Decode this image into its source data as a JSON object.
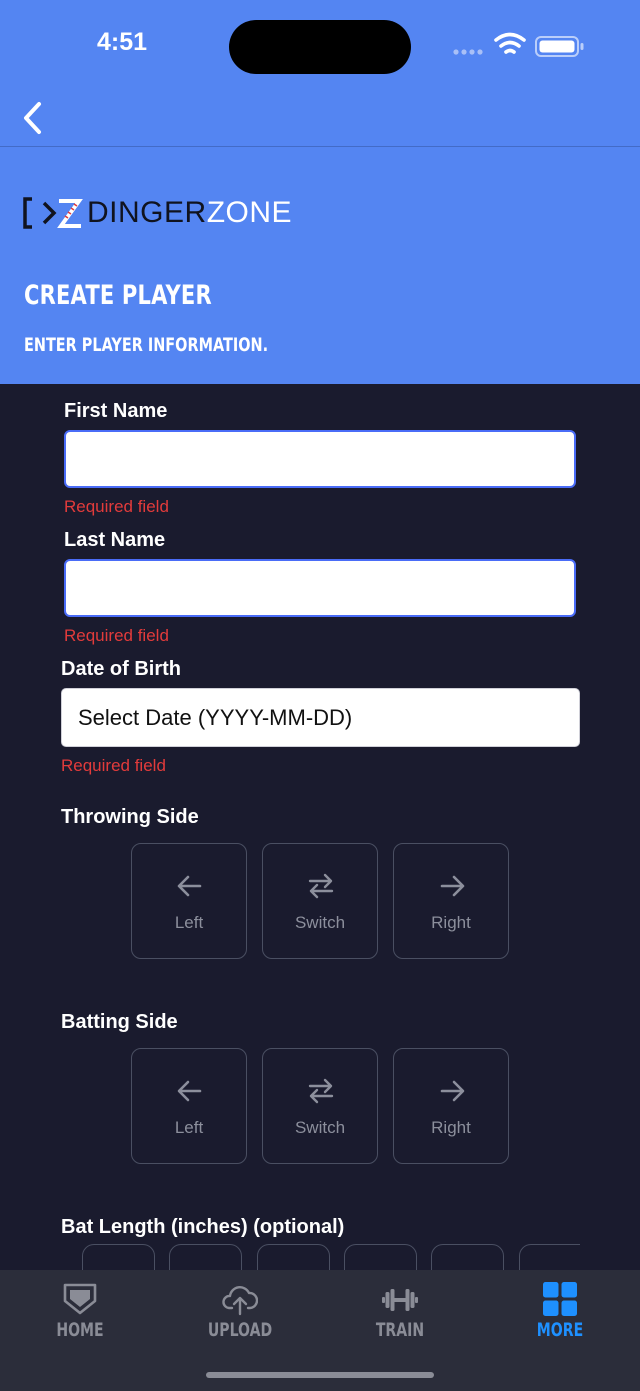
{
  "status_bar": {
    "time": "4:51"
  },
  "header": {
    "logo": {
      "text_main": "DINGER",
      "text_accent": "ZONE"
    },
    "title": "CREATE PLAYER",
    "subtitle": "ENTER PLAYER INFORMATION."
  },
  "form": {
    "first_name": {
      "label": "First Name",
      "value": "",
      "placeholder": "",
      "error": "Required field"
    },
    "last_name": {
      "label": "Last Name",
      "value": "",
      "placeholder": "",
      "error": "Required field"
    },
    "date_of_birth": {
      "label": "Date of Birth",
      "value": "Select Date (YYYY-MM-DD)",
      "error": "Required field"
    },
    "throwing_side": {
      "label": "Throwing Side",
      "options": [
        {
          "label": "Left",
          "icon": "arrow-left-icon"
        },
        {
          "label": "Switch",
          "icon": "switch-arrows-icon"
        },
        {
          "label": "Right",
          "icon": "arrow-right-icon"
        }
      ]
    },
    "batting_side": {
      "label": "Batting Side",
      "options": [
        {
          "label": "Left",
          "icon": "arrow-left-icon"
        },
        {
          "label": "Switch",
          "icon": "switch-arrows-icon"
        },
        {
          "label": "Right",
          "icon": "arrow-right-icon"
        }
      ]
    },
    "bat_length": {
      "label": "Bat Length (inches) (optional)"
    }
  },
  "tabbar": {
    "tabs": [
      {
        "label": "HOME",
        "icon": "home-plate-icon",
        "active": false
      },
      {
        "label": "UPLOAD",
        "icon": "cloud-upload-icon",
        "active": false
      },
      {
        "label": "TRAIN",
        "icon": "dumbbell-icon",
        "active": false
      },
      {
        "label": "MORE",
        "icon": "grid-icon",
        "active": true
      }
    ]
  },
  "colors": {
    "header_bg": "#5485f2",
    "page_bg": "#1a1b2e",
    "error": "#e23b3b",
    "tab_active": "#1e90ff",
    "tab_inactive": "#8a8c96",
    "tabbar_bg": "#2b2d3a"
  }
}
